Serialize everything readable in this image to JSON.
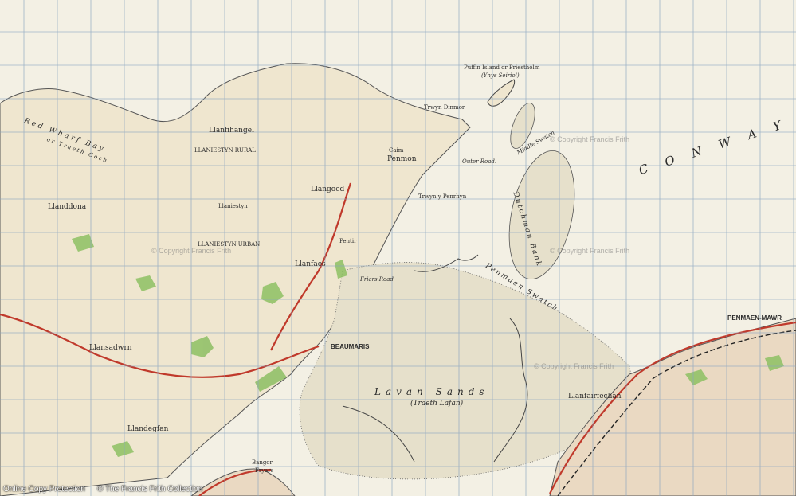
{
  "map": {
    "colors": {
      "land": "#efe9d6",
      "sea": "#f2efe2",
      "sand": "#e4dfcc",
      "grid": "#8aa4c0",
      "road_red": "#c0392b",
      "wood": "#8dbf63",
      "river": "#5b84b1"
    },
    "sea_labels": {
      "conway": "C O N W A Y",
      "lavan_sands": "Lavan  Sands",
      "traeth_lafan": "(Traeth Lafan)",
      "dutchman_bank": "Dutchman Bank",
      "penmaen_swatch": "Penmaen  Swatch",
      "red_wharf_bay": "Red Wharf Bay",
      "traeth_coch": "or Traeth Coch",
      "outer_road": "Outer Road.",
      "middle_swatch": "Middle Swatch"
    },
    "places": {
      "puffin_island": "Puffin Island or Priestholm",
      "ynys_seiriol": "(Ynys Seiriol)",
      "trwyn_dinmor": "Trwyn Dinmor",
      "penmaen_mawr": "PENMAEN-MAWR",
      "beaumaris": "BEAUMARIS",
      "llanfaes": "Llanfaes",
      "llangoed": "Llangoed",
      "llanddona": "Llanddona",
      "llaniestyn": "Llaniestyn",
      "llaniestyn_rural": "LLANIESTYN RURAL",
      "llaniestyn_urban": "LLANIESTYN URBAN",
      "llanfihangel": "Llanfihangel",
      "llansadwrn": "Llansadwrn",
      "llandegfan": "Llandegfan",
      "llanfairfechan": "Llanfairfechan",
      "penmon": "Penmon",
      "caim": "Caim",
      "friars_road": "Friars Road",
      "bangor": "Bangor",
      "fryars": "Fryars",
      "trwyn_y_penrhyn": "Trwyn y Penrhyn",
      "pentir": "Pentir"
    },
    "copyright_watermark": "© Copyright Francis Frith"
  },
  "footer": {
    "left": "Online Copy Protection",
    "right": "© The Francis Frith Collection"
  }
}
